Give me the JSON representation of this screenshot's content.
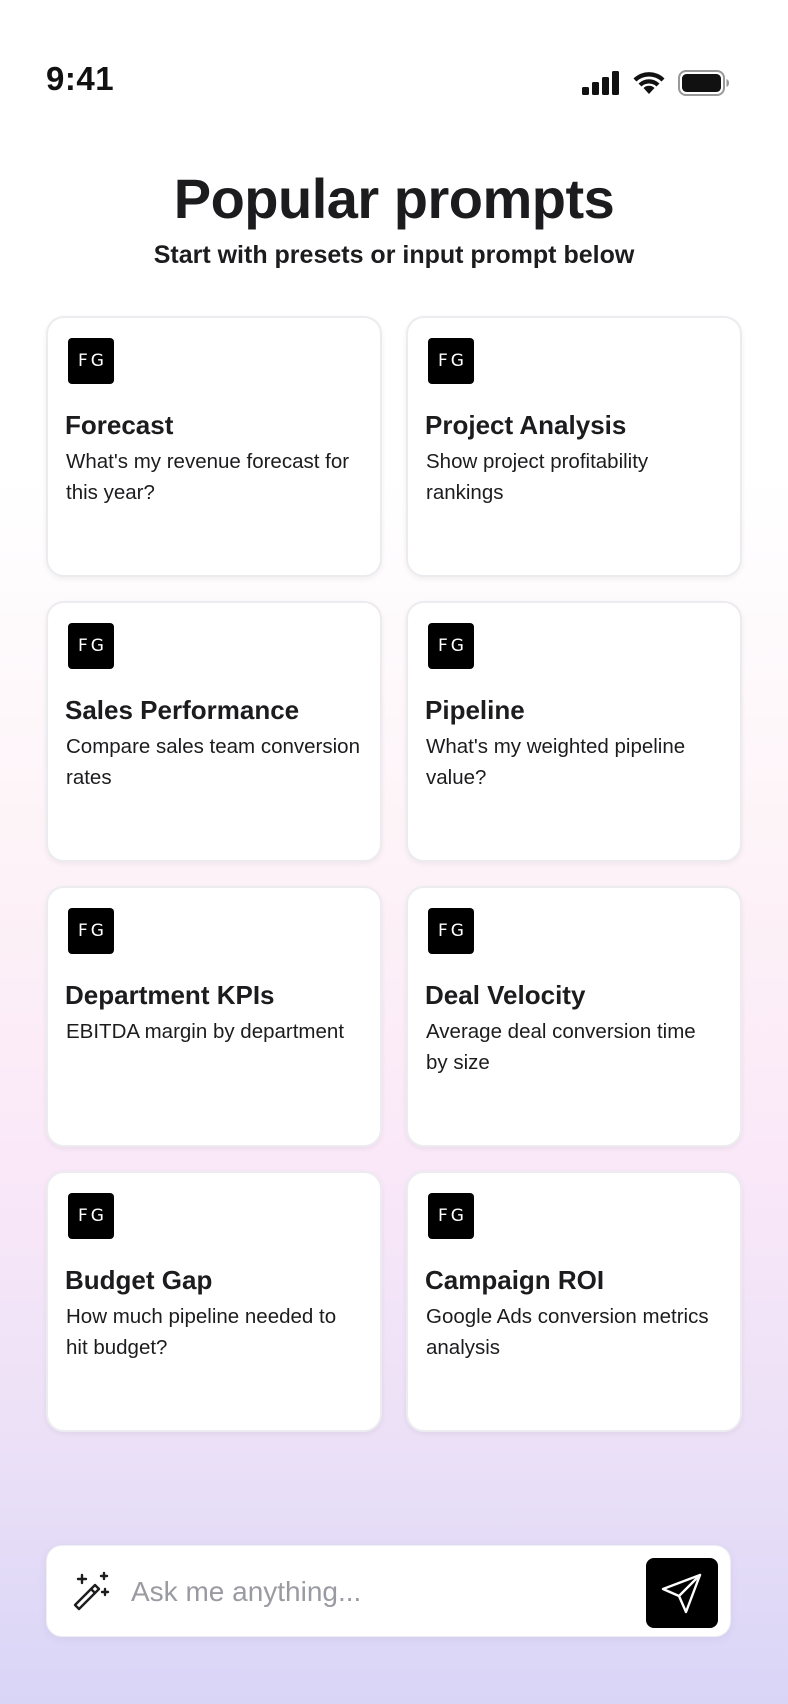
{
  "status_bar": {
    "time": "9:41",
    "icons": [
      "cellular-signal-icon",
      "wifi-icon",
      "battery-icon"
    ]
  },
  "header": {
    "title": "Popular prompts",
    "subtitle": "Start with presets or input prompt below"
  },
  "prompts": [
    {
      "badge": "FG",
      "title": "Forecast",
      "description": "What's my revenue forecast for this year?"
    },
    {
      "badge": "FG",
      "title": "Project Analysis",
      "description": "Show project profitability rankings"
    },
    {
      "badge": "FG",
      "title": "Sales Performance",
      "description": "Compare sales team conversion rates"
    },
    {
      "badge": "FG",
      "title": "Pipeline",
      "description": "What's my weighted pipeline value?"
    },
    {
      "badge": "FG",
      "title": "Department KPIs",
      "description": "EBITDA margin by department"
    },
    {
      "badge": "FG",
      "title": "Deal Velocity",
      "description": "Average deal conversion time by size"
    },
    {
      "badge": "FG",
      "title": "Budget Gap",
      "description": "How much pipeline needed to hit budget?"
    },
    {
      "badge": "FG",
      "title": "Campaign ROI",
      "description": "Google Ads conversion metrics analysis"
    }
  ],
  "input": {
    "placeholder": "Ask me anything...",
    "value": "",
    "leading_icon": "magic-wand-icon",
    "send_icon": "send-icon"
  },
  "colors": {
    "badge_bg": "#000000",
    "send_button_bg": "#000000",
    "gradient_top": "#ffffff",
    "gradient_mid": "#fae8f8",
    "gradient_bottom": "#d9d5f7"
  }
}
